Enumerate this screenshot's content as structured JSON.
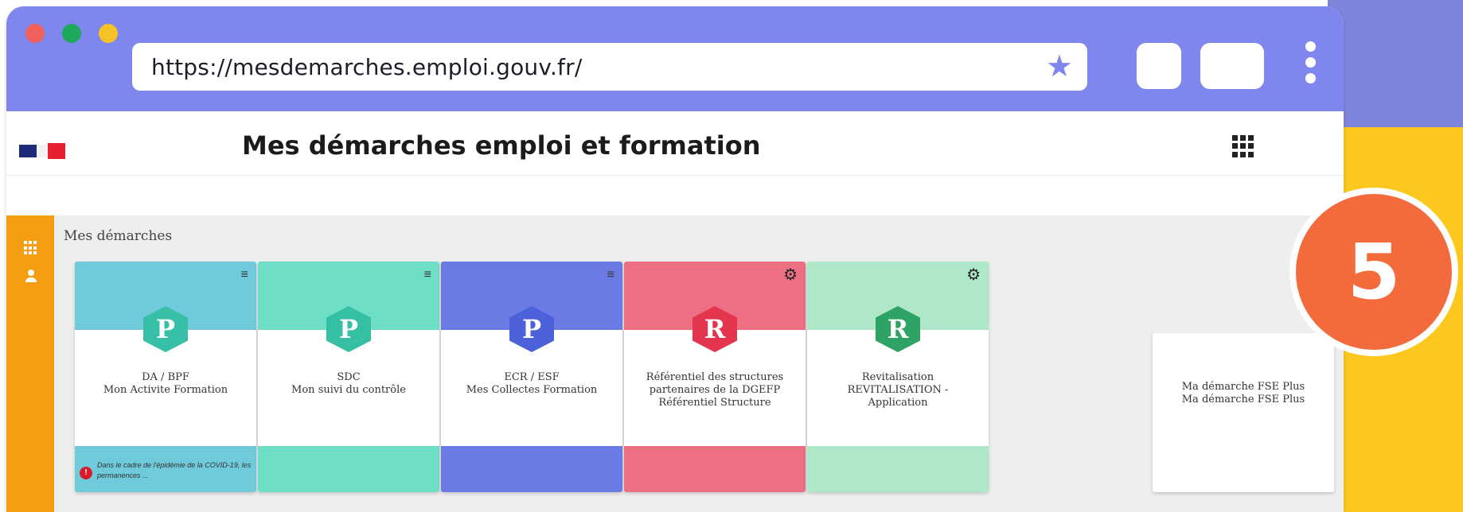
{
  "browser": {
    "url": "https://mesdemarches.emploi.gouv.fr/",
    "star_icon": "star-icon",
    "menu_icon": "kebab-menu-icon"
  },
  "site": {
    "title": "Mes démarches emploi et formation",
    "logo": "marianne-flag",
    "apps_icon": "grid-apps-icon"
  },
  "section": {
    "title": "Mes démarches"
  },
  "cards": [
    {
      "id": "da-bpf",
      "letter": "P",
      "line1": "DA / BPF",
      "line2": "Mon Activite Formation",
      "line3": "",
      "top_color": "#6fcadb",
      "hex_color": "#37bfa8",
      "bottom_color": "#6fcadb",
      "corner_icon": "list-filter-icon",
      "notice": {
        "badge": "!",
        "text": "Dans le cadre de l'épidémie de la COVID-19, les permanences ..."
      }
    },
    {
      "id": "sdc",
      "letter": "P",
      "line1": "SDC",
      "line2": "Mon suivi du contrôle",
      "line3": "",
      "top_color": "#6edfc6",
      "hex_color": "#35bfa3",
      "bottom_color": "#6edfc6",
      "corner_icon": "list-filter-icon"
    },
    {
      "id": "ecr-esf",
      "letter": "P",
      "line1": "ECR / ESF",
      "line2": "Mes Collectes Formation",
      "line3": "",
      "top_color": "#6c7ae4",
      "hex_color": "#4c61da",
      "bottom_color": "#6c7ae4",
      "corner_icon": "list-filter-icon"
    },
    {
      "id": "referentiel",
      "letter": "R",
      "line1": "Référentiel des structures",
      "line2": "partenaires de la DGEFP",
      "line3": "Référentiel Structure",
      "top_color": "#ec6f84",
      "hex_color": "#e3364e",
      "bottom_color": "#ec6f84",
      "corner_icon": "gear-icon"
    },
    {
      "id": "revitalisation",
      "letter": "R",
      "line1": "Revitalisation",
      "line2": "REVITALISATION -",
      "line3": "Application",
      "top_color": "#aee8c8",
      "hex_color": "#2ea365",
      "bottom_color": "#aee8c8",
      "corner_icon": "gear-icon"
    }
  ],
  "last_card": {
    "line1": "Ma démarche FSE Plus",
    "line2": "Ma démarche FSE Plus"
  },
  "step": {
    "number": "5"
  },
  "colors": {
    "chrome": "#7f87ee",
    "side_rail": "#f49d11",
    "step_badge": "#f36b3c",
    "bg_yellow": "#fcc81e"
  }
}
